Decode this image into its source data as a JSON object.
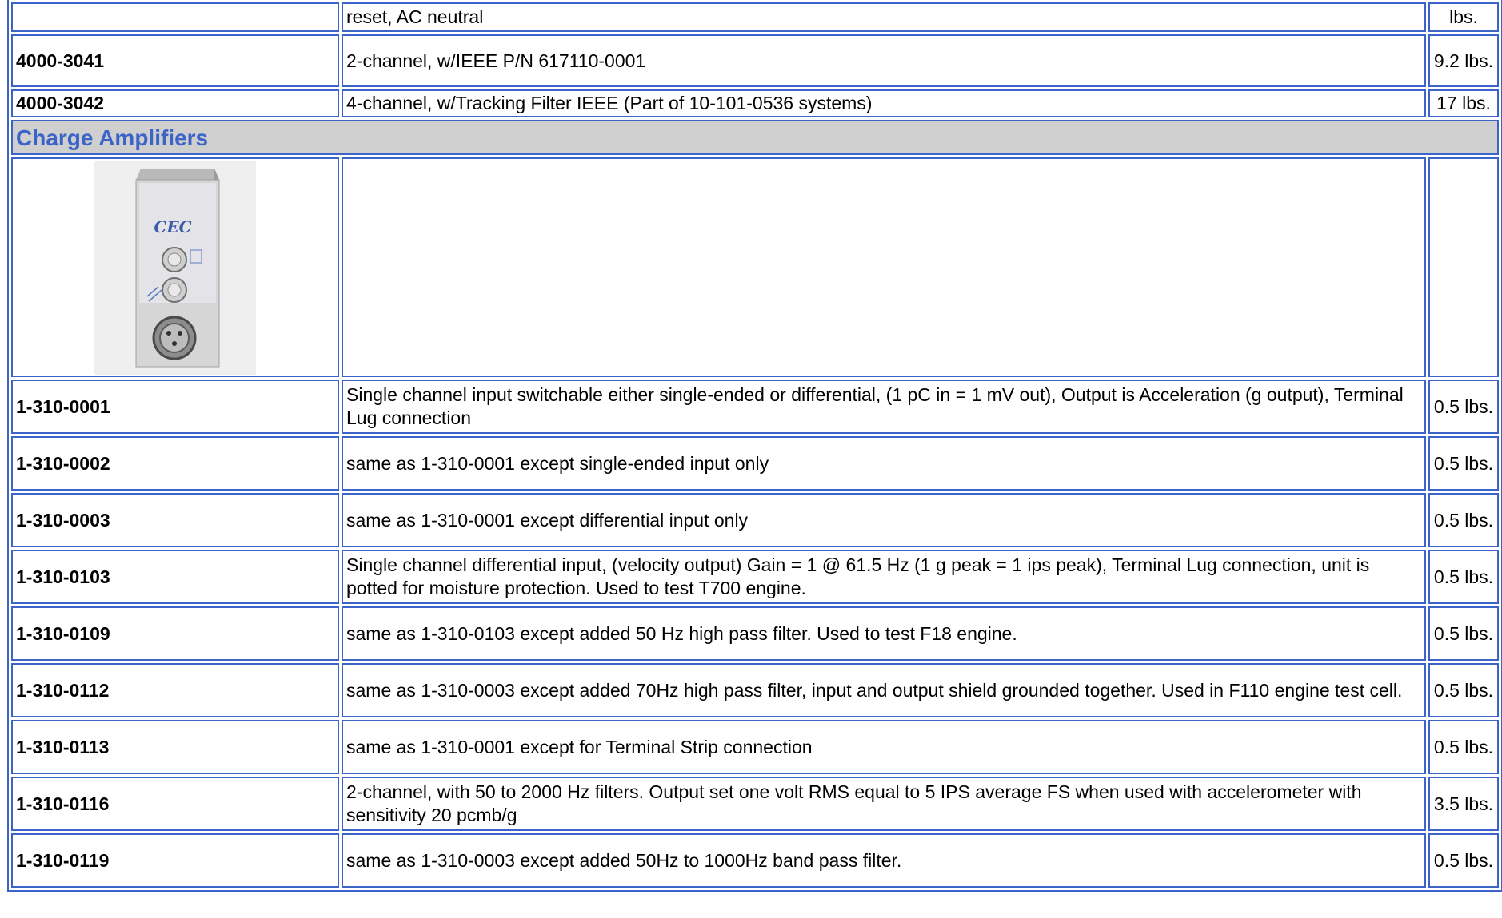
{
  "rows_top": [
    {
      "part": "",
      "desc": "reset, AC neutral",
      "weight": "lbs."
    },
    {
      "part": "4000-3041",
      "desc": "2-channel, w/IEEE P/N 617110-0001",
      "weight": "9.2 lbs."
    },
    {
      "part": "4000-3042",
      "desc": "4-channel, w/Tracking Filter IEEE (Part of 10-101-0536 systems)",
      "weight": "17 lbs."
    }
  ],
  "section": {
    "title": "Charge Amplifiers"
  },
  "image": {
    "logo_text": "CEC"
  },
  "rows": [
    {
      "part": "1-310-0001",
      "desc": "Single channel input switchable either single-ended or differential, (1 pC in = 1 mV out), Output is Acceleration (g output), Terminal Lug connection",
      "weight": "0.5 lbs."
    },
    {
      "part": "1-310-0002",
      "desc": "same as 1-310-0001 except single-ended input only",
      "weight": "0.5 lbs."
    },
    {
      "part": "1-310-0003",
      "desc": "same as 1-310-0001 except differential input only",
      "weight": "0.5 lbs."
    },
    {
      "part": "1-310-0103",
      "desc": "Single channel differential input, (velocity output) Gain = 1 @ 61.5 Hz (1 g peak = 1 ips peak), Terminal Lug connection, unit is potted for moisture protection. Used to test T700 engine.",
      "weight": "0.5 lbs."
    },
    {
      "part": "1-310-0109",
      "desc": "same as 1-310-0103 except added 50 Hz high pass filter. Used to test F18 engine.",
      "weight": "0.5 lbs."
    },
    {
      "part": "1-310-0112",
      "desc": "same as 1-310-0003 except added 70Hz high pass filter, input and output shield grounded together. Used in F110 engine test cell.",
      "weight": "0.5 lbs."
    },
    {
      "part": "1-310-0113",
      "desc": "same as 1-310-0001 except for Terminal Strip connection",
      "weight": "0.5 lbs."
    },
    {
      "part": "1-310-0116",
      "desc": "2-channel, with 50 to 2000 Hz filters. Output set one volt RMS equal to 5 IPS average FS when used with accelerometer with sensitivity 20 pcmb/g",
      "weight": "3.5 lbs."
    },
    {
      "part": "1-310-0119",
      "desc": "same as 1-310-0003 except added 50Hz to 1000Hz band pass filter.",
      "weight": "0.5 lbs."
    }
  ]
}
